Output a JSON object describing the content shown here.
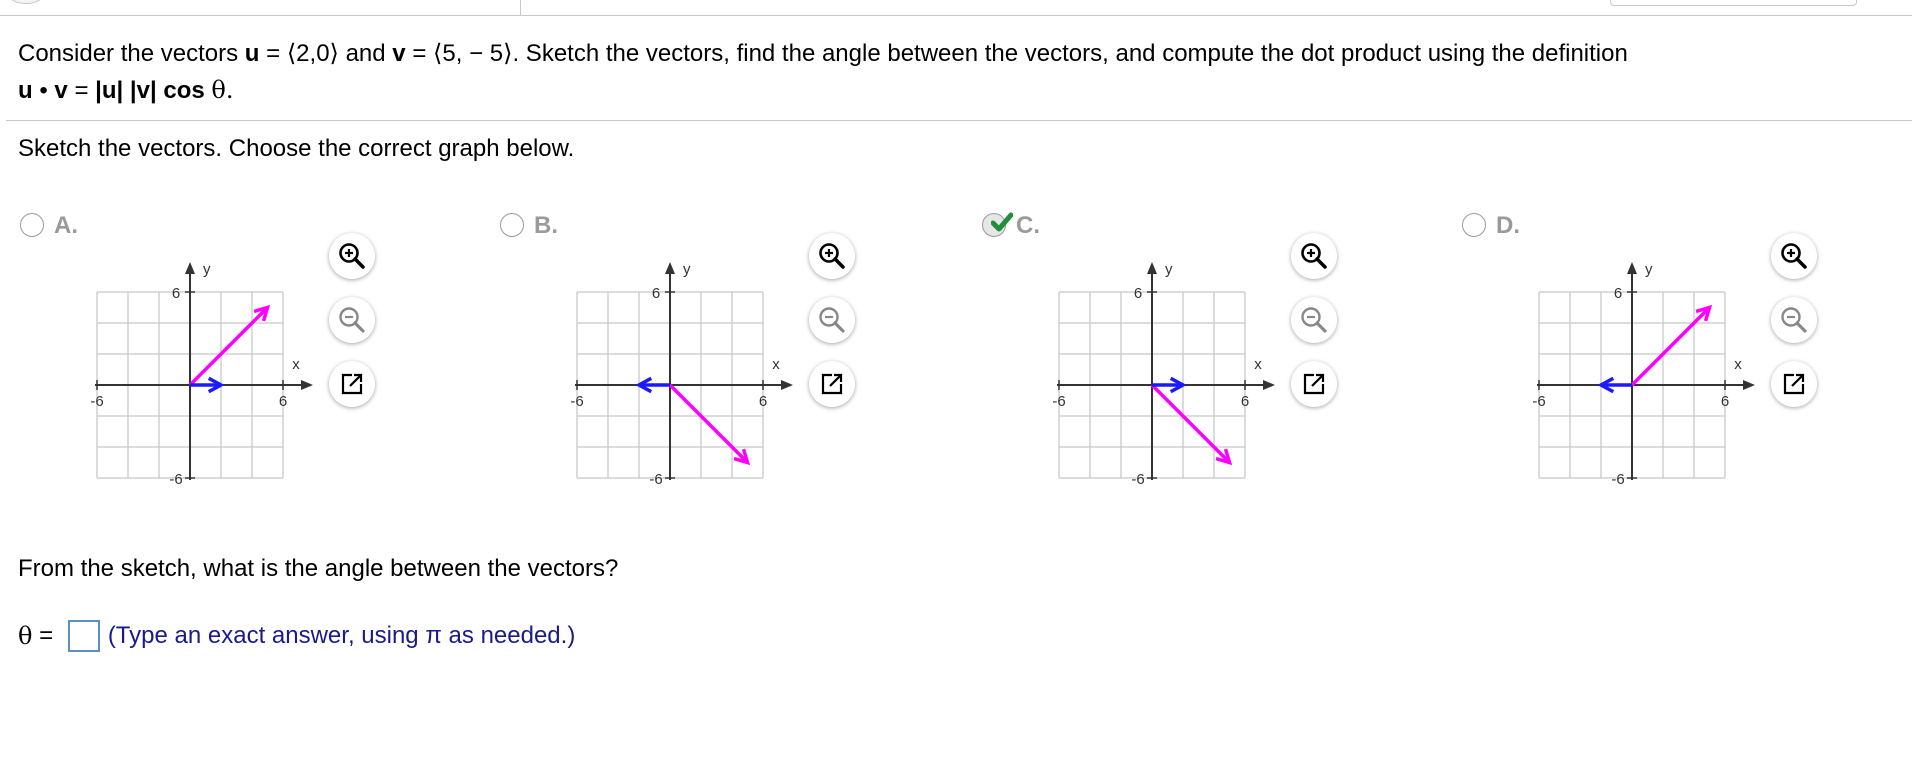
{
  "question": {
    "part1": "Consider the vectors ",
    "u": "u",
    "eq1": " = ",
    "u_value": "⟨2,0⟩",
    "and": " and ",
    "v": "v",
    "eq2": " = ",
    "v_value": "⟨5, − 5⟩",
    "part2": ". Sketch the vectors, find the angle between the vectors, and compute the dot product using the definition",
    "def_u": "u",
    "def_dot": "•",
    "def_v": "v",
    "def_eq": " = ",
    "def_abs_u": "|u|",
    "def_abs_v": "|v|",
    "def_cos": "cos",
    "def_theta": "θ."
  },
  "prompt": "Sketch the vectors. Choose the correct graph below.",
  "options": [
    {
      "letter": "A.",
      "selected": false,
      "u": [
        2,
        0
      ],
      "v": [
        5,
        5
      ]
    },
    {
      "letter": "B.",
      "selected": false,
      "u": [
        -2,
        0
      ],
      "v": [
        5,
        -5
      ]
    },
    {
      "letter": "C.",
      "selected": true,
      "u": [
        2,
        0
      ],
      "v": [
        5,
        -5
      ]
    },
    {
      "letter": "D.",
      "selected": false,
      "u": [
        -2,
        0
      ],
      "v": [
        5,
        5
      ]
    }
  ],
  "graph_labels": {
    "x": "x",
    "y": "y",
    "neg": "-6",
    "pos": "6"
  },
  "axis_range": [
    -6,
    6
  ],
  "colors": {
    "u": "#1a1aff",
    "v": "#ff00ff",
    "check": "#1f8f3a",
    "grid": "#c8c8c8",
    "axis": "#333333"
  },
  "icons": [
    "zoom-in-icon",
    "zoom-out-icon",
    "popout-icon"
  ],
  "sub_question": "From the sketch, what is the angle between the vectors?",
  "answer": {
    "theta": "θ",
    "eq": " = ",
    "value": "",
    "hint": "(Type an exact answer, using π as needed.)"
  }
}
